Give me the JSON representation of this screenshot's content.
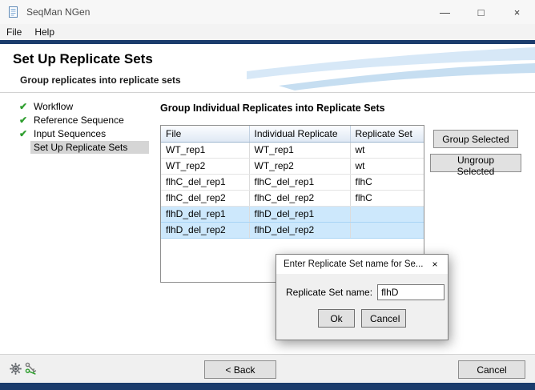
{
  "window": {
    "title": "SeqMan NGen",
    "menu": [
      {
        "label": "File"
      },
      {
        "label": "Help"
      }
    ],
    "controls": {
      "minimize": "—",
      "maximize": "□",
      "close": "×"
    }
  },
  "header": {
    "title": "Set Up Replicate Sets",
    "subtitle": "Group replicates into replicate sets"
  },
  "sidebar": {
    "check_glyph": "✔",
    "items": [
      {
        "label": "Workflow",
        "checked": true
      },
      {
        "label": "Reference Sequence",
        "checked": true
      },
      {
        "label": "Input Sequences",
        "checked": true
      },
      {
        "label": "Set Up Replicate Sets",
        "checked": false,
        "active": true
      }
    ]
  },
  "main": {
    "heading": "Group Individual Replicates into Replicate Sets",
    "table": {
      "columns": [
        "File",
        "Individual Replicate",
        "Replicate Set"
      ],
      "rows": [
        {
          "file": "WT_rep1",
          "replicate": "WT_rep1",
          "set": "wt",
          "selected": false
        },
        {
          "file": "WT_rep2",
          "replicate": "WT_rep2",
          "set": "wt",
          "selected": false
        },
        {
          "file": "flhC_del_rep1",
          "replicate": "flhC_del_rep1",
          "set": "flhC",
          "selected": false
        },
        {
          "file": "flhC_del_rep2",
          "replicate": "flhC_del_rep2",
          "set": "flhC",
          "selected": false
        },
        {
          "file": "flhD_del_rep1",
          "replicate": "flhD_del_rep1",
          "set": "",
          "selected": true
        },
        {
          "file": "flhD_del_rep2",
          "replicate": "flhD_del_rep2",
          "set": "",
          "selected": true
        }
      ]
    },
    "group_button": "Group Selected",
    "ungroup_button": "Ungroup Selected"
  },
  "dialog": {
    "title": "Enter Replicate Set name for Se...",
    "close": "×",
    "label": "Replicate Set name:",
    "input_value": "flhD",
    "ok_button": "Ok",
    "cancel_button": "Cancel"
  },
  "footer": {
    "back_button": "< Back",
    "cancel_button": "Cancel"
  },
  "colors": {
    "navy": "#1b3c6c",
    "check_green": "#2f9e2f",
    "selection_blue": "#cde8fc"
  }
}
